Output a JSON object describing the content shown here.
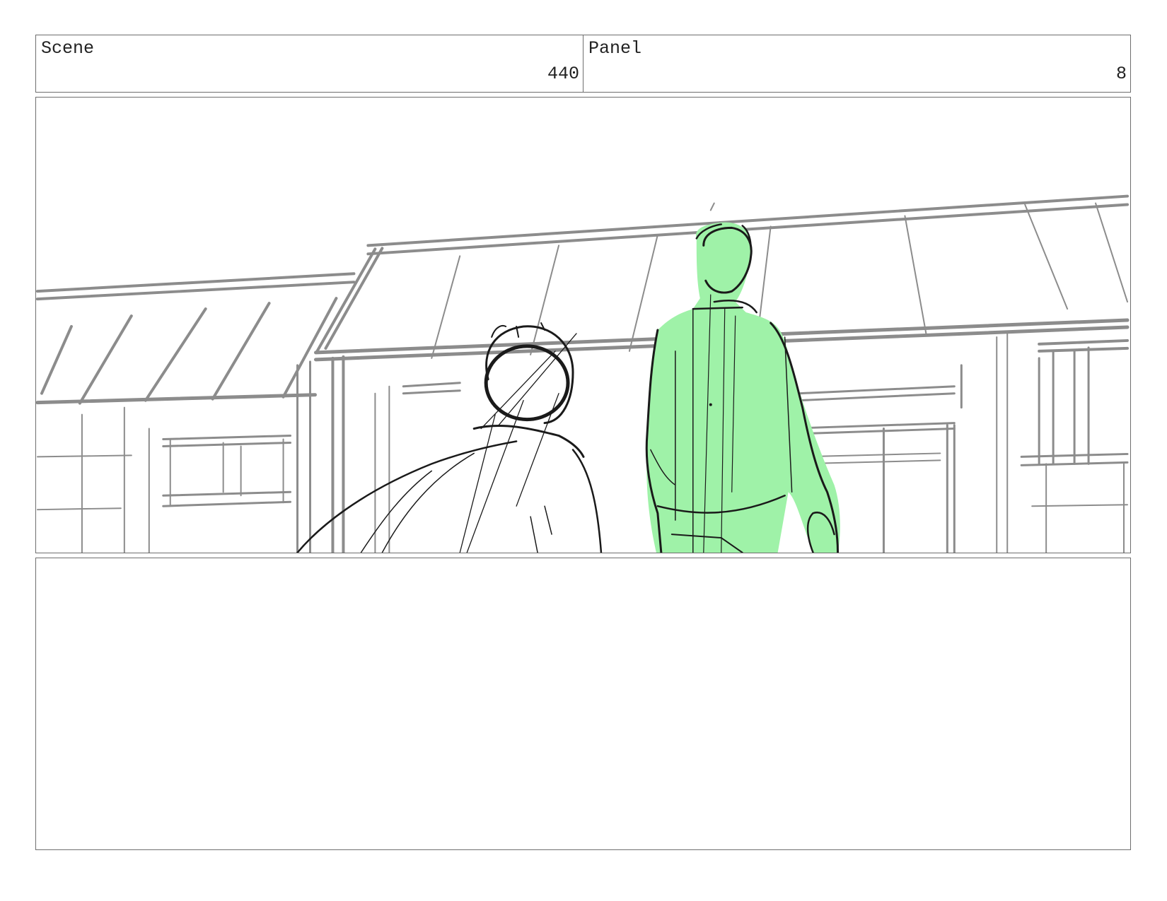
{
  "header": {
    "scene_label": "Scene",
    "scene_value": "440",
    "panel_label": "Panel",
    "panel_value": "8"
  },
  "colors": {
    "border": "#6e6e6e",
    "sketch_gray": "#8c8c8c",
    "sketch_ink": "#1a1a1a",
    "highlight_green": "#9ff2a8"
  },
  "notes": {
    "text": ""
  }
}
